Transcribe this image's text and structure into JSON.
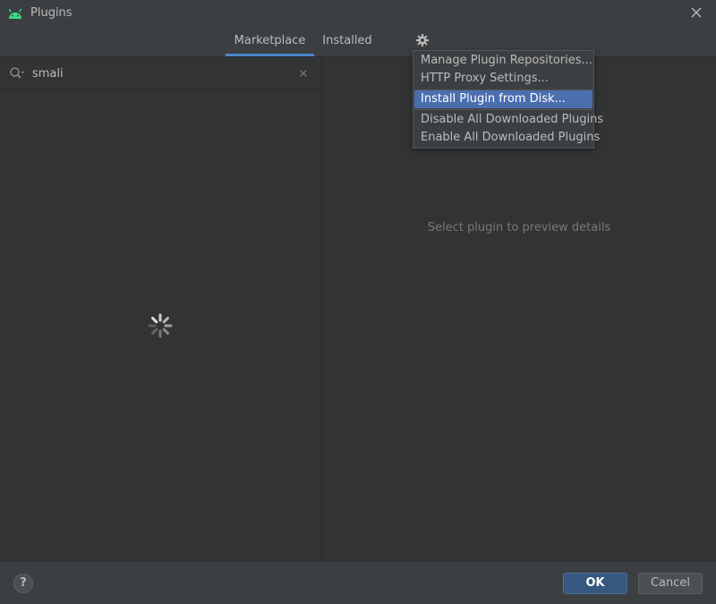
{
  "window": {
    "title": "Plugins",
    "app_icon": "android-icon",
    "close_icon": "close-icon"
  },
  "tabs": [
    {
      "label": "Marketplace",
      "active": true
    },
    {
      "label": "Installed",
      "active": false
    }
  ],
  "settings_icon": "gear-icon",
  "search": {
    "value": "smali",
    "placeholder": "",
    "icon": "search-icon",
    "clear_icon": "clear-icon"
  },
  "plugin_list": {
    "state": "loading",
    "spinner_icon": "loading-spinner-icon"
  },
  "preview": {
    "empty_text": "Select plugin to preview details"
  },
  "settings_menu": {
    "items": [
      {
        "label": "Manage Plugin Repositories...",
        "selected": false
      },
      {
        "label": "HTTP Proxy Settings...",
        "selected": false
      },
      {
        "label": "Install Plugin from Disk...",
        "selected": true
      },
      {
        "label": "Disable All Downloaded Plugins",
        "selected": false
      },
      {
        "label": "Enable All Downloaded Plugins",
        "selected": false
      }
    ]
  },
  "footer": {
    "help_label": "?",
    "ok_label": "OK",
    "cancel_label": "Cancel"
  },
  "colors": {
    "background": "#3c3f41",
    "panel": "#313335",
    "accent": "#4a88c7",
    "selection": "#4b6eaf",
    "ok_button": "#365880",
    "android_green": "#3ddc84"
  }
}
